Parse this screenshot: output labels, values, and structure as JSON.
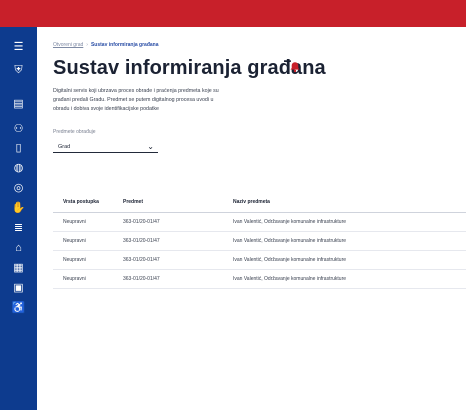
{
  "header": {
    "color": "#c8202a"
  },
  "sidebar": {
    "color": "#0d3b8e",
    "items": [
      {
        "icon": "menu-icon",
        "glyph": "☰"
      },
      {
        "icon": "crest-icon",
        "glyph": "⛨"
      },
      {
        "icon": "document-icon",
        "glyph": "▤"
      },
      {
        "icon": "people-icon",
        "glyph": "⚇"
      },
      {
        "icon": "file-icon",
        "glyph": "▯"
      },
      {
        "icon": "globe-icon",
        "glyph": "◍"
      },
      {
        "icon": "compass-icon",
        "glyph": "◎"
      },
      {
        "icon": "hand-icon",
        "glyph": "✋"
      },
      {
        "icon": "list-icon",
        "glyph": "≣"
      },
      {
        "icon": "building-icon",
        "glyph": "⌂"
      },
      {
        "icon": "archive-icon",
        "glyph": "▦"
      },
      {
        "icon": "calendar-icon",
        "glyph": "▣"
      },
      {
        "icon": "accessibility-icon",
        "glyph": "♿"
      }
    ]
  },
  "breadcrumb": {
    "home": "Otvoreni grad",
    "separator": "›",
    "current": "Sustav informiranja građana"
  },
  "page": {
    "title": "Sustav informiranja građana",
    "description_lines": [
      "Digitalni servis koji ubrzava proces obrade i praćenja predmeta koje su",
      "građani predali Gradu. Predmet se putem digitalnog procesa uvodi u",
      "obradu i dobiva svoje identifikacijske podatke"
    ]
  },
  "filter": {
    "label": "Predmete obrađuje",
    "value": "Grad"
  },
  "table": {
    "headers": [
      "Vrsta postupka",
      "Predmet",
      "Naziv predmeta"
    ],
    "rows": [
      [
        "Neupravni",
        "363-01/20-01/47",
        "Ivan Valentić, Održavanje komunalne infrastrukture"
      ],
      [
        "Neupravni",
        "363-01/20-01/47",
        "Ivan Valentić, Održavanje komunalne infrastrukture"
      ],
      [
        "Neupravni",
        "363-01/20-01/47",
        "Ivan Valentić, Održavanje komunalne infrastrukture"
      ],
      [
        "Neupravni",
        "363-01/20-01/47",
        "Ivan Valentić, Održavanje komunalne infrastrukture"
      ]
    ]
  }
}
